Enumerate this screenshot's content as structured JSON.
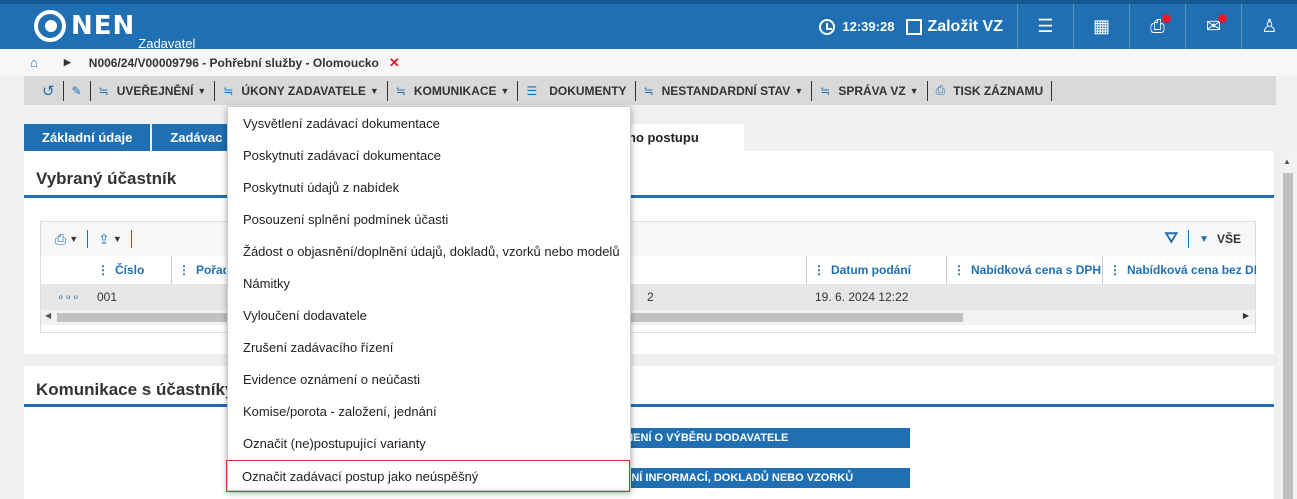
{
  "header": {
    "logo": "NEN",
    "logo_sub": "Zadavatel",
    "clock": "12:39:28",
    "new_vz": "Založit VZ",
    "icons": [
      "menu-icon",
      "calculator-icon",
      "inbox-icon",
      "mail-icon",
      "user-icon"
    ]
  },
  "breadcrumb": {
    "path": "N006/24/V00009796 - Pohřební služby - Olomoucko"
  },
  "toolbar": {
    "items": [
      {
        "label": "UVEŘEJNĚNÍ"
      },
      {
        "label": "ÚKONY ZADAVATELE"
      },
      {
        "label": "KOMUNIKACE"
      },
      {
        "label": "DOKUMENTY"
      },
      {
        "label": "NESTANDARDNÍ STAV"
      },
      {
        "label": "SPRÁVA VZ"
      },
      {
        "label": "TISK ZÁZNAMU"
      }
    ]
  },
  "tabs": [
    {
      "label": "Základní údaje"
    },
    {
      "label": "Zadávac"
    },
    {
      "label": "no postupu"
    }
  ],
  "panel1": {
    "title": "Vybraný účastník",
    "filter_label": "VŠE",
    "columns": [
      {
        "label": "Číslo"
      },
      {
        "label": "Pořadí"
      },
      {
        "label": "Datum podání"
      },
      {
        "label": "Nabídková cena s DPH"
      },
      {
        "label": "Nabídková cena bez DPH"
      }
    ],
    "row": {
      "menu": "∘∘∘",
      "cislo": "001",
      "partial": "2",
      "datum": "19. 6. 2024 12:22"
    }
  },
  "panel2": {
    "title": "Komunikace s účastníky",
    "bars": [
      "MENÍ O VÝBĚRU DODAVATELE",
      "ENÍ INFORMACÍ, DOKLADŮ NEBO VZORKŮ"
    ]
  },
  "dropdown": {
    "items": [
      "Vysvětlení zadávací dokumentace",
      "Poskytnutí zadávací dokumentace",
      "Poskytnutí údajů z nabídek",
      "Posouzení splnění podmínek účasti",
      "Žádost o objasnění/doplnění údajů, dokladů, vzorků nebo modelů",
      "Námitky",
      "Vyloučení dodavatele",
      "Zrušení zadávacího řízení",
      "Evidence oznámení o neúčasti",
      "Komise/porota - založení, jednání",
      "Označit (ne)postupující varianty",
      "Označit zadávací postup jako neúspěšný"
    ]
  }
}
